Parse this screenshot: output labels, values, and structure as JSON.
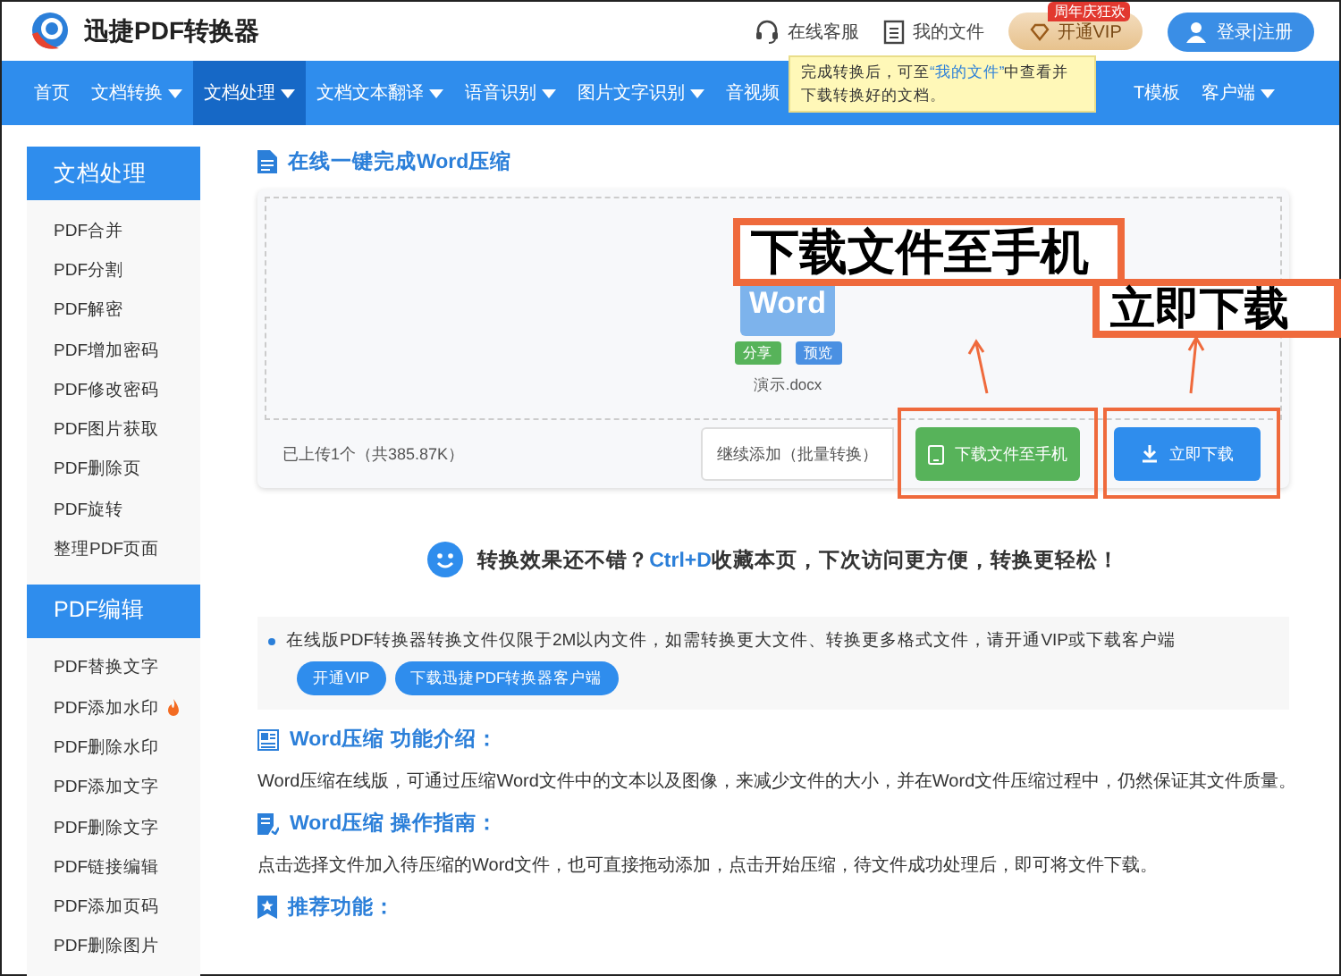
{
  "header": {
    "logo_text": "迅捷PDF转换器",
    "links": [
      {
        "label": "在线客服"
      },
      {
        "label": "我的文件"
      }
    ],
    "vip_badge": "周年庆狂欢",
    "vip_button": "开通VIP",
    "login_button": "登录|注册"
  },
  "nav": {
    "items": [
      {
        "label": "首页",
        "dropdown": false,
        "selected": false
      },
      {
        "label": "文档转换",
        "dropdown": true,
        "selected": false
      },
      {
        "label": "文档处理",
        "dropdown": true,
        "selected": true
      },
      {
        "label": "文档文本翻译",
        "dropdown": true,
        "selected": false
      },
      {
        "label": "语音识别",
        "dropdown": true,
        "selected": false
      },
      {
        "label": "图片文字识别",
        "dropdown": true,
        "selected": false
      },
      {
        "label": "音视频",
        "dropdown": false,
        "selected": false
      },
      {
        "label": "T模板",
        "dropdown": false,
        "selected": false
      },
      {
        "label": "客户端",
        "dropdown": true,
        "selected": false
      }
    ],
    "tooltip": {
      "before": "完成转换后，可至",
      "link": "“我的文件”",
      "after": "中查看并下载转换好的文档。"
    }
  },
  "sidebar": {
    "sections": [
      {
        "title": "文档处理",
        "items": [
          {
            "label": "PDF合并",
            "hot": false
          },
          {
            "label": "PDF分割",
            "hot": false
          },
          {
            "label": "PDF解密",
            "hot": false
          },
          {
            "label": "PDF增加密码",
            "hot": false
          },
          {
            "label": "PDF修改密码",
            "hot": false
          },
          {
            "label": "PDF图片获取",
            "hot": false
          },
          {
            "label": "PDF删除页",
            "hot": false
          },
          {
            "label": "PDF旋转",
            "hot": false
          },
          {
            "label": "整理PDF页面",
            "hot": false
          }
        ]
      },
      {
        "title": "PDF编辑",
        "items": [
          {
            "label": "PDF替换文字",
            "hot": false
          },
          {
            "label": "PDF添加水印",
            "hot": true
          },
          {
            "label": "PDF删除水印",
            "hot": false
          },
          {
            "label": "PDF添加文字",
            "hot": false
          },
          {
            "label": "PDF删除文字",
            "hot": false
          },
          {
            "label": "PDF链接编辑",
            "hot": false
          },
          {
            "label": "PDF添加页码",
            "hot": false
          },
          {
            "label": "PDF删除图片",
            "hot": false
          }
        ]
      }
    ]
  },
  "main": {
    "title": "在线一键完成Word压缩",
    "upload": {
      "file_icon_label": "Word",
      "file_name": "演示.docx",
      "file_actions": [
        {
          "label": "分享",
          "kind": "share"
        },
        {
          "label": "预览",
          "kind": "preview"
        }
      ],
      "status": "已上传1个（共385.87K）",
      "buttons": [
        {
          "label": "继续添加（批量转换）",
          "kind": "outline"
        },
        {
          "label": "下载文件至手机",
          "kind": "phone"
        },
        {
          "label": "立即下载",
          "kind": "download"
        }
      ],
      "annotations": [
        {
          "text": "下载文件至手机"
        },
        {
          "text": "立即下载"
        }
      ]
    },
    "promo": {
      "before": "转换效果还不错？",
      "highlight": "Ctrl+D",
      "after": "收藏本页，下次访问更方便，转换更轻松！"
    },
    "notice": {
      "text": "在线版PDF转换器转换文件仅限于2M以内文件，如需转换更大文件、转换更多格式文件，请开通VIP或下载客户端",
      "buttons": [
        "开通VIP",
        "下载迅捷PDF转换器客户端"
      ]
    },
    "sections": [
      {
        "kind": "intro",
        "heading": "Word压缩 功能介绍：",
        "body": "Word压缩在线版，可通过压缩Word文件中的文本以及图像，来减少文件的大小，并在Word文件压缩过程中，仍然保证其文件质量。"
      },
      {
        "kind": "guide",
        "heading": "Word压缩 操作指南：",
        "body": "点击选择文件加入待压缩的Word文件，也可直接拖动添加，点击开始压缩，待文件成功处理后，即可将文件下载。"
      },
      {
        "kind": "recommend",
        "heading": "推荐功能："
      }
    ]
  }
}
